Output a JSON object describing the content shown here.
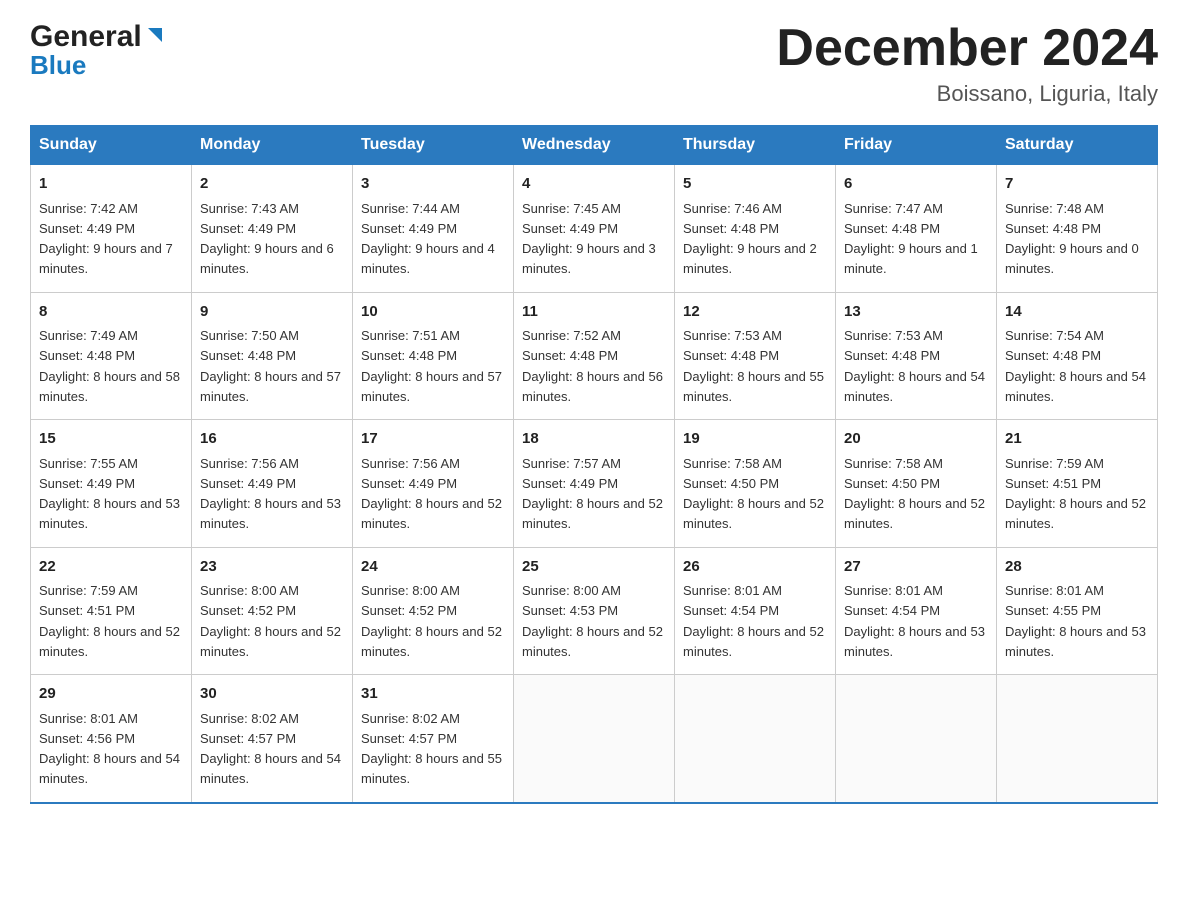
{
  "header": {
    "logo_general": "General",
    "logo_blue": "Blue",
    "title": "December 2024",
    "location": "Boissano, Liguria, Italy"
  },
  "weekdays": [
    "Sunday",
    "Monday",
    "Tuesday",
    "Wednesday",
    "Thursday",
    "Friday",
    "Saturday"
  ],
  "weeks": [
    [
      {
        "day": 1,
        "sunrise": "7:42 AM",
        "sunset": "4:49 PM",
        "daylight": "9 hours and 7 minutes."
      },
      {
        "day": 2,
        "sunrise": "7:43 AM",
        "sunset": "4:49 PM",
        "daylight": "9 hours and 6 minutes."
      },
      {
        "day": 3,
        "sunrise": "7:44 AM",
        "sunset": "4:49 PM",
        "daylight": "9 hours and 4 minutes."
      },
      {
        "day": 4,
        "sunrise": "7:45 AM",
        "sunset": "4:49 PM",
        "daylight": "9 hours and 3 minutes."
      },
      {
        "day": 5,
        "sunrise": "7:46 AM",
        "sunset": "4:48 PM",
        "daylight": "9 hours and 2 minutes."
      },
      {
        "day": 6,
        "sunrise": "7:47 AM",
        "sunset": "4:48 PM",
        "daylight": "9 hours and 1 minute."
      },
      {
        "day": 7,
        "sunrise": "7:48 AM",
        "sunset": "4:48 PM",
        "daylight": "9 hours and 0 minutes."
      }
    ],
    [
      {
        "day": 8,
        "sunrise": "7:49 AM",
        "sunset": "4:48 PM",
        "daylight": "8 hours and 58 minutes."
      },
      {
        "day": 9,
        "sunrise": "7:50 AM",
        "sunset": "4:48 PM",
        "daylight": "8 hours and 57 minutes."
      },
      {
        "day": 10,
        "sunrise": "7:51 AM",
        "sunset": "4:48 PM",
        "daylight": "8 hours and 57 minutes."
      },
      {
        "day": 11,
        "sunrise": "7:52 AM",
        "sunset": "4:48 PM",
        "daylight": "8 hours and 56 minutes."
      },
      {
        "day": 12,
        "sunrise": "7:53 AM",
        "sunset": "4:48 PM",
        "daylight": "8 hours and 55 minutes."
      },
      {
        "day": 13,
        "sunrise": "7:53 AM",
        "sunset": "4:48 PM",
        "daylight": "8 hours and 54 minutes."
      },
      {
        "day": 14,
        "sunrise": "7:54 AM",
        "sunset": "4:48 PM",
        "daylight": "8 hours and 54 minutes."
      }
    ],
    [
      {
        "day": 15,
        "sunrise": "7:55 AM",
        "sunset": "4:49 PM",
        "daylight": "8 hours and 53 minutes."
      },
      {
        "day": 16,
        "sunrise": "7:56 AM",
        "sunset": "4:49 PM",
        "daylight": "8 hours and 53 minutes."
      },
      {
        "day": 17,
        "sunrise": "7:56 AM",
        "sunset": "4:49 PM",
        "daylight": "8 hours and 52 minutes."
      },
      {
        "day": 18,
        "sunrise": "7:57 AM",
        "sunset": "4:49 PM",
        "daylight": "8 hours and 52 minutes."
      },
      {
        "day": 19,
        "sunrise": "7:58 AM",
        "sunset": "4:50 PM",
        "daylight": "8 hours and 52 minutes."
      },
      {
        "day": 20,
        "sunrise": "7:58 AM",
        "sunset": "4:50 PM",
        "daylight": "8 hours and 52 minutes."
      },
      {
        "day": 21,
        "sunrise": "7:59 AM",
        "sunset": "4:51 PM",
        "daylight": "8 hours and 52 minutes."
      }
    ],
    [
      {
        "day": 22,
        "sunrise": "7:59 AM",
        "sunset": "4:51 PM",
        "daylight": "8 hours and 52 minutes."
      },
      {
        "day": 23,
        "sunrise": "8:00 AM",
        "sunset": "4:52 PM",
        "daylight": "8 hours and 52 minutes."
      },
      {
        "day": 24,
        "sunrise": "8:00 AM",
        "sunset": "4:52 PM",
        "daylight": "8 hours and 52 minutes."
      },
      {
        "day": 25,
        "sunrise": "8:00 AM",
        "sunset": "4:53 PM",
        "daylight": "8 hours and 52 minutes."
      },
      {
        "day": 26,
        "sunrise": "8:01 AM",
        "sunset": "4:54 PM",
        "daylight": "8 hours and 52 minutes."
      },
      {
        "day": 27,
        "sunrise": "8:01 AM",
        "sunset": "4:54 PM",
        "daylight": "8 hours and 53 minutes."
      },
      {
        "day": 28,
        "sunrise": "8:01 AM",
        "sunset": "4:55 PM",
        "daylight": "8 hours and 53 minutes."
      }
    ],
    [
      {
        "day": 29,
        "sunrise": "8:01 AM",
        "sunset": "4:56 PM",
        "daylight": "8 hours and 54 minutes."
      },
      {
        "day": 30,
        "sunrise": "8:02 AM",
        "sunset": "4:57 PM",
        "daylight": "8 hours and 54 minutes."
      },
      {
        "day": 31,
        "sunrise": "8:02 AM",
        "sunset": "4:57 PM",
        "daylight": "8 hours and 55 minutes."
      },
      null,
      null,
      null,
      null
    ]
  ]
}
